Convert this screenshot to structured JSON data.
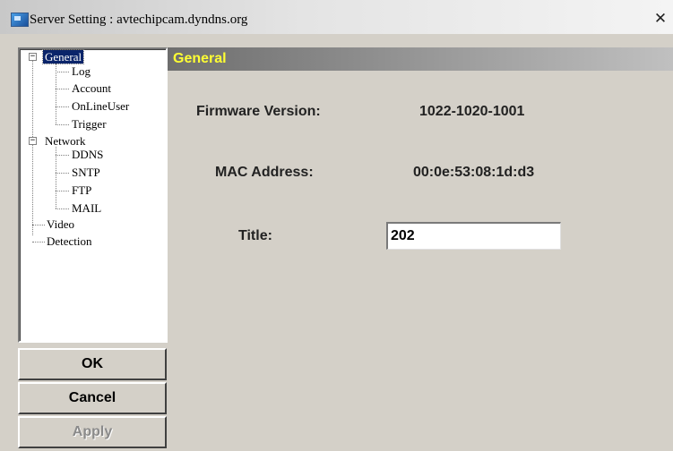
{
  "window": {
    "title": "Server Setting : avtechipcam.dyndns.org",
    "close_glyph": "✕"
  },
  "tree": {
    "expander_glyph": "−",
    "groups": [
      {
        "label": "General",
        "expanded": true,
        "selected": true,
        "children": [
          "Log",
          "Account",
          "OnLineUser",
          "Trigger"
        ]
      },
      {
        "label": "Network",
        "expanded": true,
        "selected": false,
        "children": [
          "DDNS",
          "SNTP",
          "FTP",
          "MAIL"
        ]
      }
    ],
    "leaves": [
      "Video",
      "Detection"
    ]
  },
  "buttons": {
    "ok": "OK",
    "cancel": "Cancel",
    "apply": "Apply"
  },
  "panel": {
    "header": "General",
    "firmware_label": "Firmware Version:",
    "firmware_value": "1022-1020-1001",
    "mac_label": "MAC Address:",
    "mac_value": "00:0e:53:08:1d:d3",
    "title_label": "Title:",
    "title_value": "202"
  },
  "colors": {
    "header_text": "#ffff33",
    "selection": "#0a246a",
    "face": "#d4d0c8"
  },
  "icons": {
    "app": "app-window-icon",
    "close": "close-icon",
    "expander": "tree-collapse-icon"
  }
}
